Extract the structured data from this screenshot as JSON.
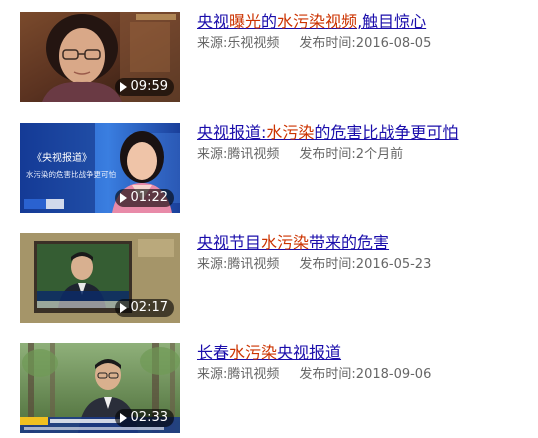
{
  "results": [
    {
      "title_parts": [
        {
          "text": "央视",
          "hl": false
        },
        {
          "text": "曝光",
          "hl": true
        },
        {
          "text": "的",
          "hl": false
        },
        {
          "text": "水污染",
          "hl": true
        },
        {
          "text": "视频",
          "hl": true
        },
        {
          "text": ",触目惊心",
          "hl": false
        }
      ],
      "source_label": "来源:",
      "source": "乐视视频",
      "date_label": "发布时间:",
      "date": "2016-08-05",
      "duration": "09:59",
      "thumb_icon": "news-interview-thumbnail"
    },
    {
      "title_parts": [
        {
          "text": "央视报道",
          "hl": false
        },
        {
          "text": ":",
          "hl": false
        },
        {
          "text": "水污染",
          "hl": true
        },
        {
          "text": "的危害比战争更可怕",
          "hl": false
        }
      ],
      "source_label": "来源:",
      "source": "腾讯视频",
      "date_label": "发布时间:",
      "date": "2个月前",
      "duration": "01:22",
      "thumb_icon": "news-anchor-thumbnail",
      "thumb_caption_1": "《央视报道》",
      "thumb_caption_2": "水污染的危害比战争更可怕"
    },
    {
      "title_parts": [
        {
          "text": "央视节目",
          "hl": false
        },
        {
          "text": "水污染",
          "hl": true
        },
        {
          "text": "带来的危害",
          "hl": false
        }
      ],
      "source_label": "来源:",
      "source": "腾讯视频",
      "date_label": "发布时间:",
      "date": "2016-05-23",
      "duration": "02:17",
      "thumb_icon": "tv-program-thumbnail"
    },
    {
      "title_parts": [
        {
          "text": "长春",
          "hl": false
        },
        {
          "text": "水污染",
          "hl": true
        },
        {
          "text": "央视报道",
          "hl": false
        }
      ],
      "source_label": "来源:",
      "source": "腾讯视频",
      "date_label": "发布时间:",
      "date": "2018-09-06",
      "duration": "02:33",
      "thumb_icon": "outdoor-report-thumbnail"
    }
  ],
  "colors": {
    "title": "#1a0dab",
    "highlight": "#cc3300",
    "meta": "#666666"
  }
}
